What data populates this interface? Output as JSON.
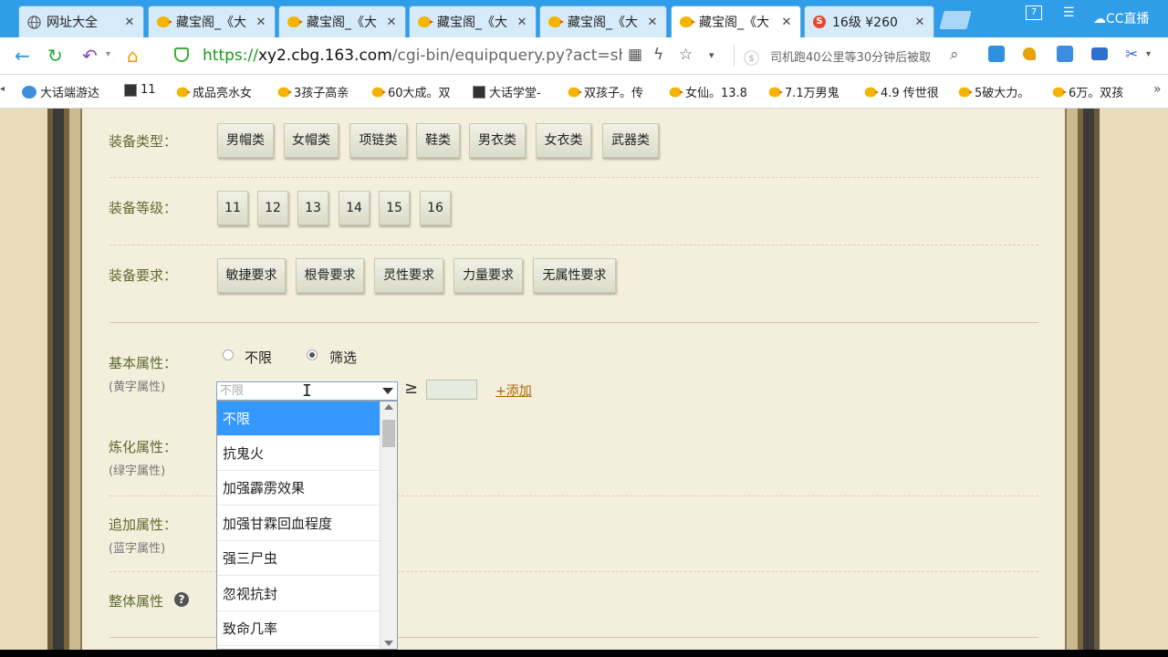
{
  "tabs": [
    {
      "title": "网址大全",
      "icon": "globe-icon"
    },
    {
      "title": "藏宝阁_《大",
      "icon": "chick-icon"
    },
    {
      "title": "藏宝阁_《大",
      "icon": "chick-icon"
    },
    {
      "title": "藏宝阁_《大",
      "icon": "chick-icon"
    },
    {
      "title": "藏宝阁_《大",
      "icon": "chick-icon"
    },
    {
      "title": "藏宝阁_《大",
      "icon": "chick-icon",
      "active": true
    },
    {
      "title": "16级 ¥260",
      "icon": "sohu-icon"
    }
  ],
  "window": {
    "badge": "7",
    "brand": "CC直播"
  },
  "address": {
    "scheme": "https://",
    "host": "xy2.cbg.163.com",
    "path": "/cgi-bin/equipquery.py?act=show_",
    "news": "司机跑40公里等30分钟后被取"
  },
  "bookmarks": [
    "大话端游达",
    "11",
    "成品亮水女",
    "3孩子高亲",
    "60大成。双",
    "大话学堂-",
    "双孩子。传",
    "女仙。13.8",
    "7.1万男鬼",
    "4.9 传世很",
    "5破大力。",
    "6万。双孩"
  ],
  "filters": {
    "type": {
      "label": "装备类型：",
      "options": [
        "男帽类",
        "女帽类",
        "项链类",
        "鞋类",
        "男衣类",
        "女衣类",
        "武器类"
      ]
    },
    "level": {
      "label": "装备等级：",
      "options": [
        "11",
        "12",
        "13",
        "14",
        "15",
        "16"
      ]
    },
    "requirement": {
      "label": "装备要求：",
      "options": [
        "敏捷要求",
        "根骨要求",
        "灵性要求",
        "力量要求",
        "无属性要求"
      ]
    }
  },
  "basic": {
    "label": "基本属性：",
    "sub": "(黄字属性)",
    "radio_all": "不限",
    "radio_filter": "筛选",
    "select_value": "不限",
    "gte": "≥",
    "add_link": "+添加"
  },
  "refine": {
    "label": "炼化属性：",
    "sub": "(绿字属性)"
  },
  "extra": {
    "label": "追加属性：",
    "sub": "(蓝字属性)"
  },
  "overall": {
    "label": "整体属性",
    "help": "?"
  },
  "dropdown_options": [
    "不限",
    "抗鬼火",
    "加强霹雳效果",
    "加强甘霖回血程度",
    "强三尸虫",
    "忽视抗封",
    "致命几率"
  ]
}
